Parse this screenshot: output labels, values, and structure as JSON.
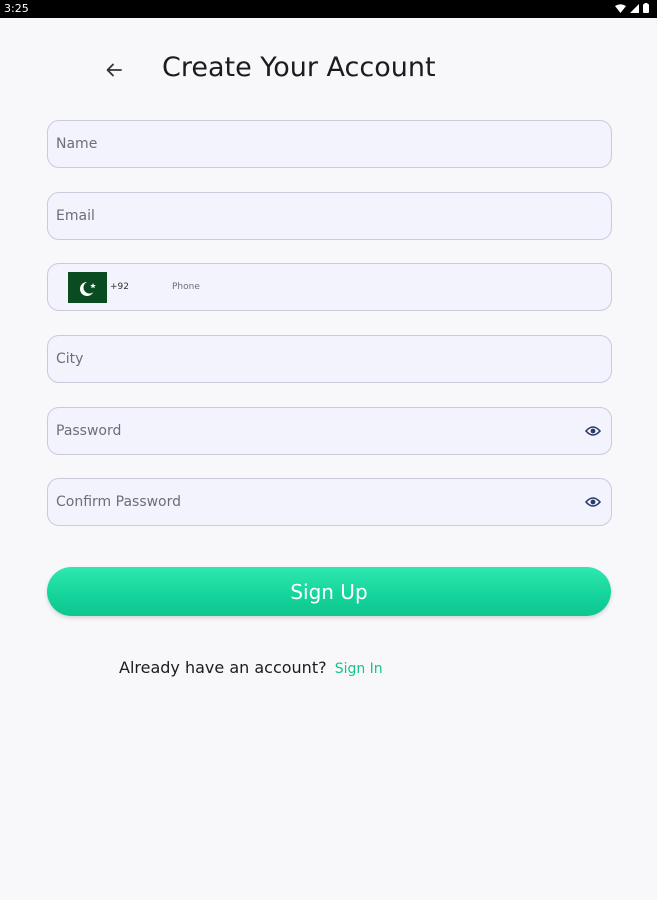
{
  "status_bar": {
    "time": "3:25"
  },
  "header": {
    "title": "Create Your Account"
  },
  "form": {
    "name_placeholder": "Name",
    "email_placeholder": "Email",
    "phone": {
      "country_code": "+92",
      "placeholder": "Phone"
    },
    "city_placeholder": "City",
    "password_placeholder": "Password",
    "confirm_password_placeholder": "Confirm Password"
  },
  "signup_label": "Sign Up",
  "footer": {
    "prompt": "Already have an account?",
    "link": "Sign In"
  },
  "colors": {
    "accent": "#14d39a",
    "field_bg": "#f3f3fe",
    "flag_green": "#0b4b22"
  }
}
